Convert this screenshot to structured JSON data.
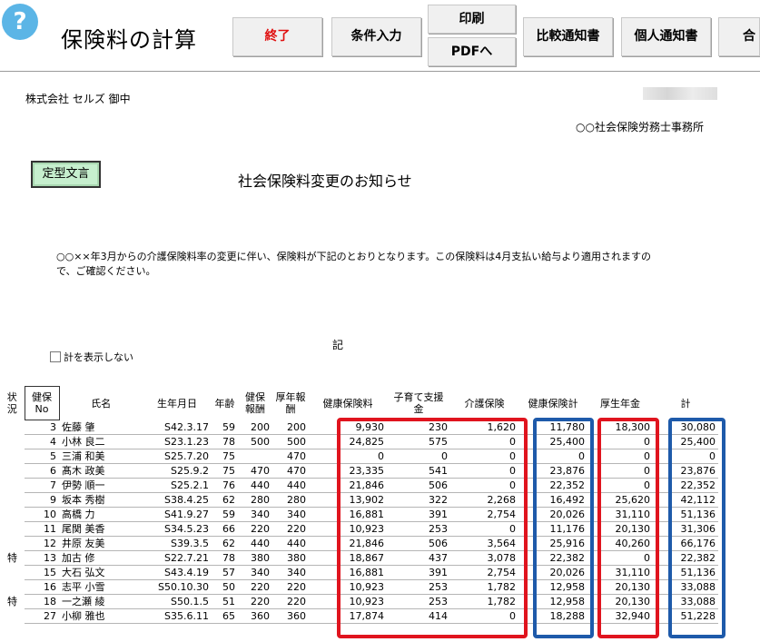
{
  "header": {
    "help_icon": "?",
    "title": "保険料の計算",
    "buttons": {
      "exit": "終了",
      "condition": "条件入力",
      "print": "印刷",
      "pdf": "PDFへ",
      "compare": "比較通知書",
      "personal": "個人通知書",
      "total": "合計"
    }
  },
  "doc": {
    "company": "株式会社 セルズ 御中",
    "office": "○○社会保険労務士事務所",
    "template_button": "定型文言",
    "notice_title": "社会保険料変更のお知らせ",
    "body": "○○××年3月からの介護保険料率の変更に伴い、保険料が下記のとおりとなります。この保険料は4月支払い給与より適用されますので、ご確認ください。",
    "ki": "記",
    "hide_total_label": "計を表示しない"
  },
  "table": {
    "headers": {
      "status": "状況",
      "kenpo_no": "健保No",
      "name": "氏名",
      "birth": "生年月日",
      "age": "年齢",
      "kenpo_salary": "健保報酬",
      "kosei_salary": "厚年報酬",
      "health_ins": "健康保険料",
      "child_support": "子育て支援金",
      "care_ins": "介護保険",
      "health_total": "健康保険計",
      "pension": "厚生年金",
      "total": "計"
    },
    "rows": [
      {
        "status": "",
        "no": "3",
        "name": "佐藤 肇",
        "birth": "S42.3.17",
        "age": "59",
        "ks": "200",
        "ps": "200",
        "health": "9,930",
        "child": "230",
        "care": "1,620",
        "htotal": "11,780",
        "pension": "18,300",
        "total": "30,080"
      },
      {
        "status": "",
        "no": "4",
        "name": "小林 良二",
        "birth": "S23.1.23",
        "age": "78",
        "ks": "500",
        "ps": "500",
        "health": "24,825",
        "child": "575",
        "care": "0",
        "htotal": "25,400",
        "pension": "0",
        "total": "25,400"
      },
      {
        "status": "",
        "no": "5",
        "name": "三浦 和美",
        "birth": "S25.7.20",
        "age": "75",
        "ks": "",
        "ps": "470",
        "health": "0",
        "child": "0",
        "care": "0",
        "htotal": "0",
        "pension": "0",
        "total": "0"
      },
      {
        "status": "",
        "no": "6",
        "name": "髙木 政美",
        "birth": "S25.9.2",
        "age": "75",
        "ks": "470",
        "ps": "470",
        "health": "23,335",
        "child": "541",
        "care": "0",
        "htotal": "23,876",
        "pension": "0",
        "total": "23,876"
      },
      {
        "status": "",
        "no": "7",
        "name": "伊勢 順一",
        "birth": "S25.2.1",
        "age": "76",
        "ks": "440",
        "ps": "440",
        "health": "21,846",
        "child": "506",
        "care": "0",
        "htotal": "22,352",
        "pension": "0",
        "total": "22,352"
      },
      {
        "status": "",
        "no": "9",
        "name": "坂本 秀樹",
        "birth": "S38.4.25",
        "age": "62",
        "ks": "280",
        "ps": "280",
        "health": "13,902",
        "child": "322",
        "care": "2,268",
        "htotal": "16,492",
        "pension": "25,620",
        "total": "42,112"
      },
      {
        "status": "",
        "no": "10",
        "name": "高橋 力",
        "birth": "S41.9.27",
        "age": "59",
        "ks": "340",
        "ps": "340",
        "health": "16,881",
        "child": "391",
        "care": "2,754",
        "htotal": "20,026",
        "pension": "31,110",
        "total": "51,136"
      },
      {
        "status": "",
        "no": "11",
        "name": "尾関 美香",
        "birth": "S34.5.23",
        "age": "66",
        "ks": "220",
        "ps": "220",
        "health": "10,923",
        "child": "253",
        "care": "0",
        "htotal": "11,176",
        "pension": "20,130",
        "total": "31,306"
      },
      {
        "status": "",
        "no": "12",
        "name": "井原 友美",
        "birth": "S39.3.5",
        "age": "62",
        "ks": "440",
        "ps": "440",
        "health": "21,846",
        "child": "506",
        "care": "3,564",
        "htotal": "25,916",
        "pension": "40,260",
        "total": "66,176"
      },
      {
        "status": "特",
        "no": "13",
        "name": "加古 修",
        "birth": "S22.7.21",
        "age": "78",
        "ks": "380",
        "ps": "380",
        "health": "18,867",
        "child": "437",
        "care": "3,078",
        "htotal": "22,382",
        "pension": "0",
        "total": "22,382"
      },
      {
        "status": "",
        "no": "15",
        "name": "大石 弘文",
        "birth": "S43.4.19",
        "age": "57",
        "ks": "340",
        "ps": "340",
        "health": "16,881",
        "child": "391",
        "care": "2,754",
        "htotal": "20,026",
        "pension": "31,110",
        "total": "51,136"
      },
      {
        "status": "",
        "no": "16",
        "name": "志平 小雪",
        "birth": "S50.10.30",
        "age": "50",
        "ks": "220",
        "ps": "220",
        "health": "10,923",
        "child": "253",
        "care": "1,782",
        "htotal": "12,958",
        "pension": "20,130",
        "total": "33,088"
      },
      {
        "status": "特",
        "no": "18",
        "name": "一之瀬 綾",
        "birth": "S50.1.5",
        "age": "51",
        "ks": "220",
        "ps": "220",
        "health": "10,923",
        "child": "253",
        "care": "1,782",
        "htotal": "12,958",
        "pension": "20,130",
        "total": "33,088"
      },
      {
        "status": "",
        "no": "27",
        "name": "小柳 雅也",
        "birth": "S35.6.11",
        "age": "65",
        "ks": "360",
        "ps": "360",
        "health": "17,874",
        "child": "414",
        "care": "0",
        "htotal": "18,288",
        "pension": "32,940",
        "total": "51,228"
      }
    ]
  },
  "colors": {
    "highlight_red": "#e0141e",
    "highlight_blue": "#1e5aaa",
    "template_green": "#c6efce",
    "help_blue": "#5bb5e6"
  }
}
